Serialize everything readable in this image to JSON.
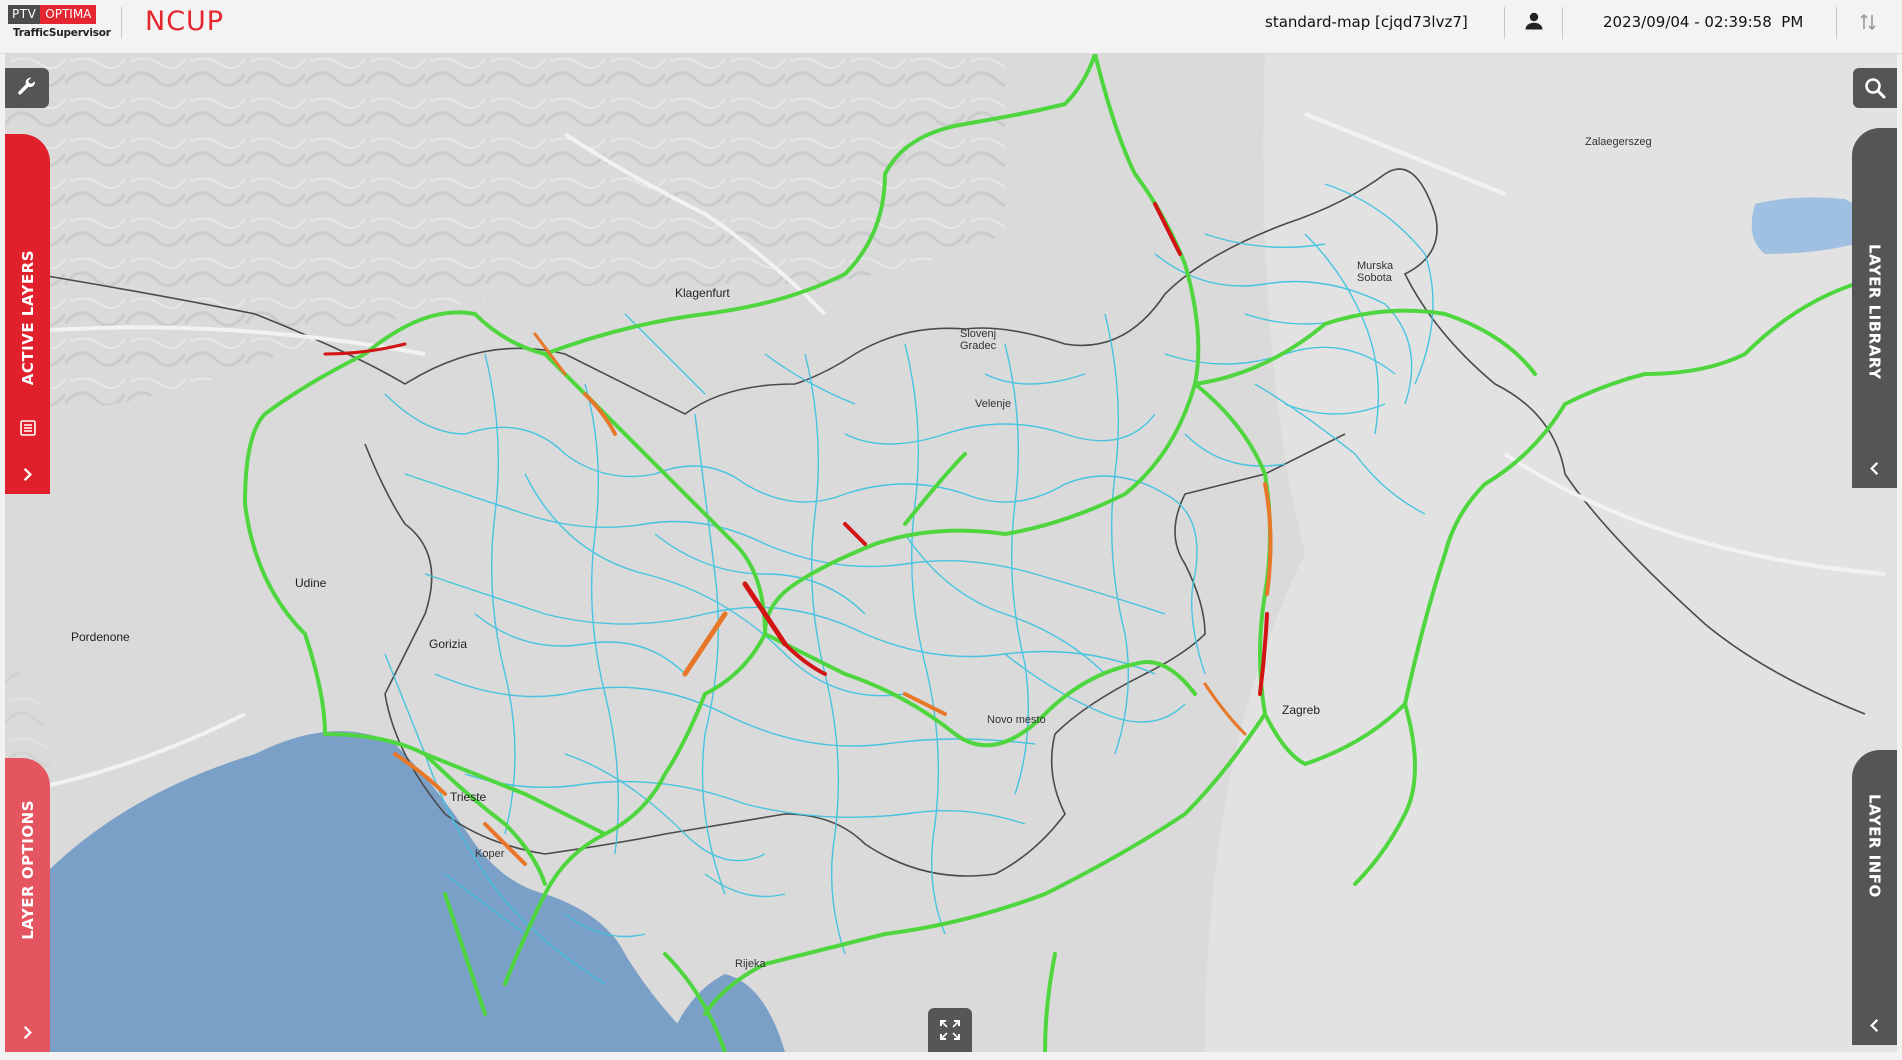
{
  "header": {
    "logo_ptv": "PTV",
    "logo_optima": "OPTIMA",
    "logo_sub": "TrafficSupervisor",
    "app_title": "NCUP",
    "map_name": "standard-map [cjqd73lvz7]",
    "datetime": "2023/09/04 - 02:39:58  PM"
  },
  "icons": {
    "user": "user-icon",
    "sort": "sort-arrows-icon",
    "tools": "wrench-icon",
    "search": "search-icon",
    "expand": "fullscreen-expand-icon"
  },
  "tabs": {
    "active_layers": "ACTIVE LAYERS",
    "layer_options": "LAYER OPTIONS",
    "layer_library": "LAYER LIBRARY",
    "layer_info": "LAYER INFO"
  },
  "map": {
    "labels": {
      "zalaegerszeg": "Zalaegerszeg",
      "klagenfurt": "Klagenfurt",
      "slovenj_gradec": "Slovenj Gradec",
      "velenje": "Velenje",
      "murska_sobota": "Murska Sobota",
      "udine": "Udine",
      "pordenone": "Pordenone",
      "gorizia": "Gorizia",
      "trieste": "Trieste",
      "koper": "Koper",
      "novo_mesto": "Novo mesto",
      "zagreb": "Zagreb",
      "rijeka": "Rijeka"
    }
  },
  "colors": {
    "brand_red": "#e3262f",
    "tab_red": "#e0202b",
    "tab_red_light": "#e45560",
    "tab_gray": "#555555",
    "road_network": "#3fc3e0",
    "highway_free": "#4fd63f",
    "congestion_orange": "#e8772a",
    "congestion_red": "#d21414",
    "sea": "#7ba0c8",
    "land": "#d9d9d9",
    "border": "#4a4a4a"
  }
}
